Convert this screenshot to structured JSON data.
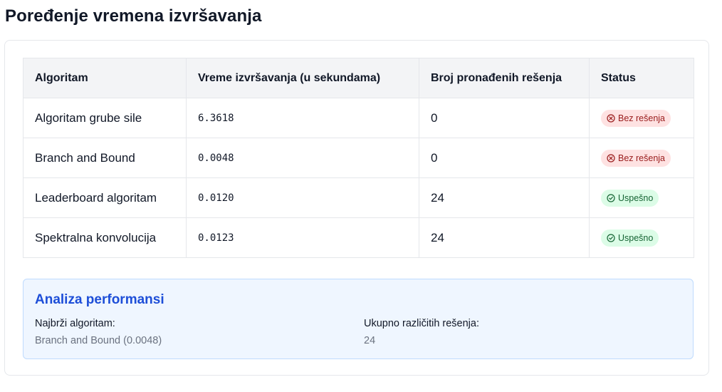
{
  "page_title": "Poređenje vremena izvršavanja",
  "table": {
    "headers": [
      "Algoritam",
      "Vreme izvršavanja (u sekundama)",
      "Broj pronađenih rešenja",
      "Status"
    ],
    "rows": [
      {
        "algorithm": "Algoritam grube sile",
        "time": "6.3618",
        "solutions": "0",
        "status": "Bez rešenja",
        "status_type": "error",
        "status_icon": "x-circle-icon"
      },
      {
        "algorithm": "Branch and Bound",
        "time": "0.0048",
        "solutions": "0",
        "status": "Bez rešenja",
        "status_type": "error",
        "status_icon": "x-circle-icon"
      },
      {
        "algorithm": "Leaderboard algoritam",
        "time": "0.0120",
        "solutions": "24",
        "status": "Uspešno",
        "status_type": "success",
        "status_icon": "check-circle-icon"
      },
      {
        "algorithm": "Spektralna konvolucija",
        "time": "0.0123",
        "solutions": "24",
        "status": "Uspešno",
        "status_type": "success",
        "status_icon": "check-circle-icon"
      }
    ]
  },
  "analysis": {
    "title": "Analiza performansi",
    "fastest_label": "Najbrži algoritam:",
    "fastest_value": "Branch and Bound (0.0048)",
    "total_label": "Ukupno različitih rešenja:",
    "total_value": "24"
  },
  "colors": {
    "error_bg": "#fee2e2",
    "error_text": "#991b1b",
    "success_bg": "#dcfce7",
    "success_text": "#166534",
    "accent": "#1d4ed8"
  }
}
